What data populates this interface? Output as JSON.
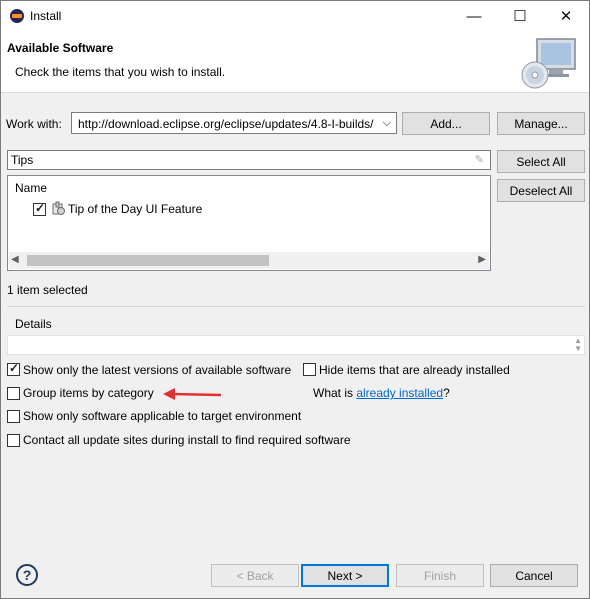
{
  "window": {
    "title": "Install",
    "minimize_glyph": "—",
    "maximize_glyph": "☐",
    "close_glyph": "✕"
  },
  "header": {
    "title": "Available Software",
    "description": "Check the items that you wish to install."
  },
  "work_with": {
    "label": "Work with:",
    "value": "http://download.eclipse.org/eclipse/updates/4.8-I-builds/",
    "add_label": "Add...",
    "manage_label": "Manage..."
  },
  "filter": {
    "value": "Tips"
  },
  "selection_buttons": {
    "select_all": "Select All",
    "deselect_all": "Deselect All"
  },
  "tree": {
    "column_header": "Name",
    "items": [
      {
        "label": "Tip of the Day UI Feature",
        "checked": true,
        "icon": "feature-icon"
      }
    ]
  },
  "status": "1 item selected",
  "details": {
    "label": "Details",
    "text": ""
  },
  "options": {
    "show_latest": {
      "label": "Show only the latest versions of available software",
      "checked": true
    },
    "hide_installed": {
      "label": "Hide items that are already installed",
      "checked": false
    },
    "group_by_category": {
      "label": "Group items by category",
      "checked": false
    },
    "what_is_prefix": "What is ",
    "what_is_link": "already installed",
    "what_is_suffix": "?",
    "show_applicable": {
      "label": "Show only software applicable to target environment",
      "checked": false
    },
    "contact_sites": {
      "label": "Contact all update sites during install to find required software",
      "checked": false
    }
  },
  "annotation": {
    "arrow_color": "#e03030"
  },
  "footer": {
    "back": "< Back",
    "next": "Next >",
    "finish": "Finish",
    "cancel": "Cancel"
  },
  "colors": {
    "accent": "#0078d7",
    "link": "#0066cc"
  }
}
